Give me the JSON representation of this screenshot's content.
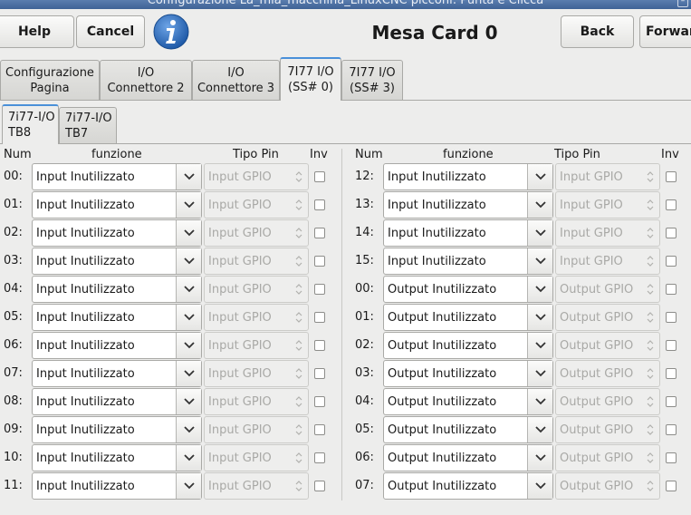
{
  "window": {
    "title": "Configurazione La_mia_macchina_LinuxCNC picconi: Punta e Clicca"
  },
  "toolbar": {
    "help_label": "Help",
    "cancel_label": "Cancel",
    "page_title": "Mesa Card 0",
    "back_label": "Back",
    "forward_label": "Forward"
  },
  "tabs": [
    {
      "label": "Configurazione\nPagina"
    },
    {
      "label": "I/O\nConnettore 2"
    },
    {
      "label": "I/O\nConnettore 3"
    },
    {
      "label": "7I77 I/O\n(SS# 0)"
    },
    {
      "label": "7I77 I/O\n(SS# 3)"
    }
  ],
  "subtabs": [
    {
      "label": "7i77-I/O\nTB8"
    },
    {
      "label": "7i77-I/O\nTB7"
    }
  ],
  "headers": {
    "num": "Num",
    "function": "funzione",
    "pin_type": "Tipo Pin",
    "inv": "Inv"
  },
  "left_rows": [
    {
      "num": "00:",
      "function": "Input Inutilizzato",
      "pin_type": "Input GPIO"
    },
    {
      "num": "01:",
      "function": "Input Inutilizzato",
      "pin_type": "Input GPIO"
    },
    {
      "num": "02:",
      "function": "Input Inutilizzato",
      "pin_type": "Input GPIO"
    },
    {
      "num": "03:",
      "function": "Input Inutilizzato",
      "pin_type": "Input GPIO"
    },
    {
      "num": "04:",
      "function": "Input Inutilizzato",
      "pin_type": "Input GPIO"
    },
    {
      "num": "05:",
      "function": "Input Inutilizzato",
      "pin_type": "Input GPIO"
    },
    {
      "num": "06:",
      "function": "Input Inutilizzato",
      "pin_type": "Input GPIO"
    },
    {
      "num": "07:",
      "function": "Input Inutilizzato",
      "pin_type": "Input GPIO"
    },
    {
      "num": "08:",
      "function": "Input Inutilizzato",
      "pin_type": "Input GPIO"
    },
    {
      "num": "09:",
      "function": "Input Inutilizzato",
      "pin_type": "Input GPIO"
    },
    {
      "num": "10:",
      "function": "Input Inutilizzato",
      "pin_type": "Input GPIO"
    },
    {
      "num": "11:",
      "function": "Input Inutilizzato",
      "pin_type": "Input GPIO"
    }
  ],
  "right_rows": [
    {
      "num": "12:",
      "function": "Input Inutilizzato",
      "pin_type": "Input GPIO"
    },
    {
      "num": "13:",
      "function": "Input Inutilizzato",
      "pin_type": "Input GPIO"
    },
    {
      "num": "14:",
      "function": "Input Inutilizzato",
      "pin_type": "Input GPIO"
    },
    {
      "num": "15:",
      "function": "Input Inutilizzato",
      "pin_type": "Input GPIO"
    },
    {
      "num": "00:",
      "function": "Output Inutilizzato",
      "pin_type": "Output GPIO"
    },
    {
      "num": "01:",
      "function": "Output Inutilizzato",
      "pin_type": "Output GPIO"
    },
    {
      "num": "02:",
      "function": "Output Inutilizzato",
      "pin_type": "Output GPIO"
    },
    {
      "num": "03:",
      "function": "Output Inutilizzato",
      "pin_type": "Output GPIO"
    },
    {
      "num": "04:",
      "function": "Output Inutilizzato",
      "pin_type": "Output GPIO"
    },
    {
      "num": "05:",
      "function": "Output Inutilizzato",
      "pin_type": "Output GPIO"
    },
    {
      "num": "06:",
      "function": "Output Inutilizzato",
      "pin_type": "Output GPIO"
    },
    {
      "num": "07:",
      "function": "Output Inutilizzato",
      "pin_type": "Output GPIO"
    }
  ],
  "icons": {
    "info": "info-icon",
    "dropdown": "chevron-down-icon",
    "spin": "spin-arrows-icon"
  },
  "colors": {
    "accent": "#4a90d9",
    "info_icon": "#2f6db3",
    "titlebar": "#4a6fa5"
  }
}
